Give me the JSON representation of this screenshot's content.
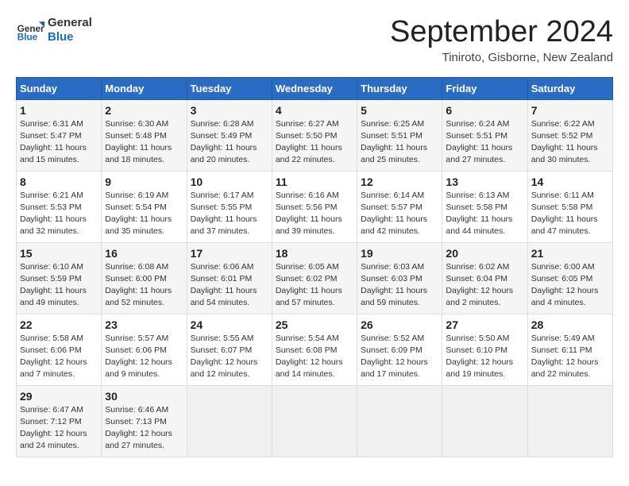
{
  "logo": {
    "general": "General",
    "blue": "Blue"
  },
  "title": "September 2024",
  "subtitle": "Tiniroto, Gisborne, New Zealand",
  "weekdays": [
    "Sunday",
    "Monday",
    "Tuesday",
    "Wednesday",
    "Thursday",
    "Friday",
    "Saturday"
  ],
  "weeks": [
    [
      {
        "day": "1",
        "info": "Sunrise: 6:31 AM\nSunset: 5:47 PM\nDaylight: 11 hours\nand 15 minutes."
      },
      {
        "day": "2",
        "info": "Sunrise: 6:30 AM\nSunset: 5:48 PM\nDaylight: 11 hours\nand 18 minutes."
      },
      {
        "day": "3",
        "info": "Sunrise: 6:28 AM\nSunset: 5:49 PM\nDaylight: 11 hours\nand 20 minutes."
      },
      {
        "day": "4",
        "info": "Sunrise: 6:27 AM\nSunset: 5:50 PM\nDaylight: 11 hours\nand 22 minutes."
      },
      {
        "day": "5",
        "info": "Sunrise: 6:25 AM\nSunset: 5:51 PM\nDaylight: 11 hours\nand 25 minutes."
      },
      {
        "day": "6",
        "info": "Sunrise: 6:24 AM\nSunset: 5:51 PM\nDaylight: 11 hours\nand 27 minutes."
      },
      {
        "day": "7",
        "info": "Sunrise: 6:22 AM\nSunset: 5:52 PM\nDaylight: 11 hours\nand 30 minutes."
      }
    ],
    [
      {
        "day": "8",
        "info": "Sunrise: 6:21 AM\nSunset: 5:53 PM\nDaylight: 11 hours\nand 32 minutes."
      },
      {
        "day": "9",
        "info": "Sunrise: 6:19 AM\nSunset: 5:54 PM\nDaylight: 11 hours\nand 35 minutes."
      },
      {
        "day": "10",
        "info": "Sunrise: 6:17 AM\nSunset: 5:55 PM\nDaylight: 11 hours\nand 37 minutes."
      },
      {
        "day": "11",
        "info": "Sunrise: 6:16 AM\nSunset: 5:56 PM\nDaylight: 11 hours\nand 39 minutes."
      },
      {
        "day": "12",
        "info": "Sunrise: 6:14 AM\nSunset: 5:57 PM\nDaylight: 11 hours\nand 42 minutes."
      },
      {
        "day": "13",
        "info": "Sunrise: 6:13 AM\nSunset: 5:58 PM\nDaylight: 11 hours\nand 44 minutes."
      },
      {
        "day": "14",
        "info": "Sunrise: 6:11 AM\nSunset: 5:58 PM\nDaylight: 11 hours\nand 47 minutes."
      }
    ],
    [
      {
        "day": "15",
        "info": "Sunrise: 6:10 AM\nSunset: 5:59 PM\nDaylight: 11 hours\nand 49 minutes."
      },
      {
        "day": "16",
        "info": "Sunrise: 6:08 AM\nSunset: 6:00 PM\nDaylight: 11 hours\nand 52 minutes."
      },
      {
        "day": "17",
        "info": "Sunrise: 6:06 AM\nSunset: 6:01 PM\nDaylight: 11 hours\nand 54 minutes."
      },
      {
        "day": "18",
        "info": "Sunrise: 6:05 AM\nSunset: 6:02 PM\nDaylight: 11 hours\nand 57 minutes."
      },
      {
        "day": "19",
        "info": "Sunrise: 6:03 AM\nSunset: 6:03 PM\nDaylight: 11 hours\nand 59 minutes."
      },
      {
        "day": "20",
        "info": "Sunrise: 6:02 AM\nSunset: 6:04 PM\nDaylight: 12 hours\nand 2 minutes."
      },
      {
        "day": "21",
        "info": "Sunrise: 6:00 AM\nSunset: 6:05 PM\nDaylight: 12 hours\nand 4 minutes."
      }
    ],
    [
      {
        "day": "22",
        "info": "Sunrise: 5:58 AM\nSunset: 6:06 PM\nDaylight: 12 hours\nand 7 minutes."
      },
      {
        "day": "23",
        "info": "Sunrise: 5:57 AM\nSunset: 6:06 PM\nDaylight: 12 hours\nand 9 minutes."
      },
      {
        "day": "24",
        "info": "Sunrise: 5:55 AM\nSunset: 6:07 PM\nDaylight: 12 hours\nand 12 minutes."
      },
      {
        "day": "25",
        "info": "Sunrise: 5:54 AM\nSunset: 6:08 PM\nDaylight: 12 hours\nand 14 minutes."
      },
      {
        "day": "26",
        "info": "Sunrise: 5:52 AM\nSunset: 6:09 PM\nDaylight: 12 hours\nand 17 minutes."
      },
      {
        "day": "27",
        "info": "Sunrise: 5:50 AM\nSunset: 6:10 PM\nDaylight: 12 hours\nand 19 minutes."
      },
      {
        "day": "28",
        "info": "Sunrise: 5:49 AM\nSunset: 6:11 PM\nDaylight: 12 hours\nand 22 minutes."
      }
    ],
    [
      {
        "day": "29",
        "info": "Sunrise: 6:47 AM\nSunset: 7:12 PM\nDaylight: 12 hours\nand 24 minutes."
      },
      {
        "day": "30",
        "info": "Sunrise: 6:46 AM\nSunset: 7:13 PM\nDaylight: 12 hours\nand 27 minutes."
      },
      {
        "day": "",
        "info": ""
      },
      {
        "day": "",
        "info": ""
      },
      {
        "day": "",
        "info": ""
      },
      {
        "day": "",
        "info": ""
      },
      {
        "day": "",
        "info": ""
      }
    ]
  ]
}
